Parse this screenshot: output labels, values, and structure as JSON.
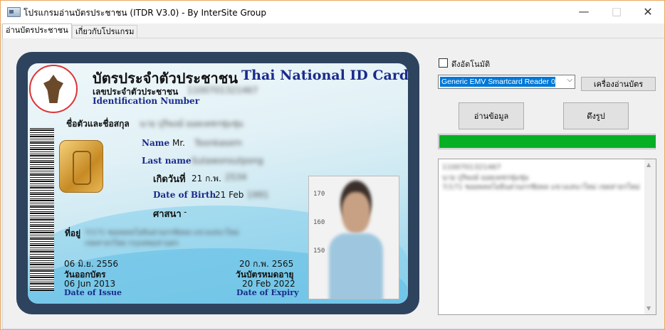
{
  "window": {
    "title": "โปรแกรมอ่านบัตรประชาชน (ITDR V3.0) - By InterSite Group",
    "icons": [
      "app-icon",
      "minimize-icon",
      "maximize-icon",
      "close-icon"
    ]
  },
  "tabs": [
    {
      "label": "อ่านบัตรประชาชน",
      "active": true
    },
    {
      "label": "เกี่ยวกับโปรแกรม",
      "active": false
    }
  ],
  "card": {
    "title_th": "บัตรประจำตัวประชาชน",
    "title_en": "Thai National ID Card",
    "id_label_th": "เลขประจำตัวประชาชน",
    "id_label_en": "Identification Number",
    "id_number": "1100701321467",
    "name_th_label": "ชื่อตัวและชื่อสกุล",
    "name_th_value": "นาย ปุริพงษ์ ยอดเพชรชุ่มชุ่ม",
    "name_en_label": "Name",
    "name_en_prefix": "Mr.",
    "name_en_value": "Toonkasem",
    "lastname_en_label": "Last name",
    "lastname_en_value": "Sutawonsutpong",
    "dob_th_label": "เกิดวันที่",
    "dob_th_value": "21 ก.พ.",
    "dob_th_year": "2534",
    "dob_en_label": "Date of Birth",
    "dob_en_value": "21 Feb",
    "dob_en_year": "1991",
    "religion_label": "ศาสนา",
    "religion_value": "-",
    "address_label": "ที่อยู่",
    "address_line1": "7/171 ซอยพหลโยธินสวนกรชัยพล แขวงเสนาใหม่",
    "address_line2": "เขตสาธรใหม่ กรุงเทพมหานคร",
    "issue_th_value": "06 มิ.ย. 2556",
    "issue_th_label": "วันออกบัตร",
    "issue_en_value": "06 Jun 2013",
    "issue_en_label": "Date of Issue",
    "expiry_th_value": "20 ก.พ. 2565",
    "expiry_th_label": "วันบัตรหมดอายุ",
    "expiry_en_value": "20 Feb 2022",
    "expiry_en_label": "Date of Expiry",
    "photo_scale": [
      "170",
      "160",
      "150"
    ],
    "icons": [
      "garuda-seal-icon",
      "smartcard-chip-icon",
      "barcode-icon"
    ]
  },
  "controls": {
    "auto_read_label": "ดึงอัตโนมัติ",
    "auto_read_checked": false,
    "reader_selected": "Generic EMV Smartcard Reader 0",
    "reader_button": "เครื่องอ่านบัตร",
    "read_button": "อ่านข้อมูล",
    "photo_button": "ดึงรูป",
    "progress_fraction": 1.0,
    "progress_color": "#06b025"
  },
  "output": {
    "lines": [
      "1100701321467",
      "นาย ปุริพงษ์ ยอดเพชรชุ่มชุ่ม",
      "7/171 ซอยพหลโยธินสวนกรชัยพล แขวงเสนาใหม่ เขตสาธรใหม่"
    ]
  }
}
